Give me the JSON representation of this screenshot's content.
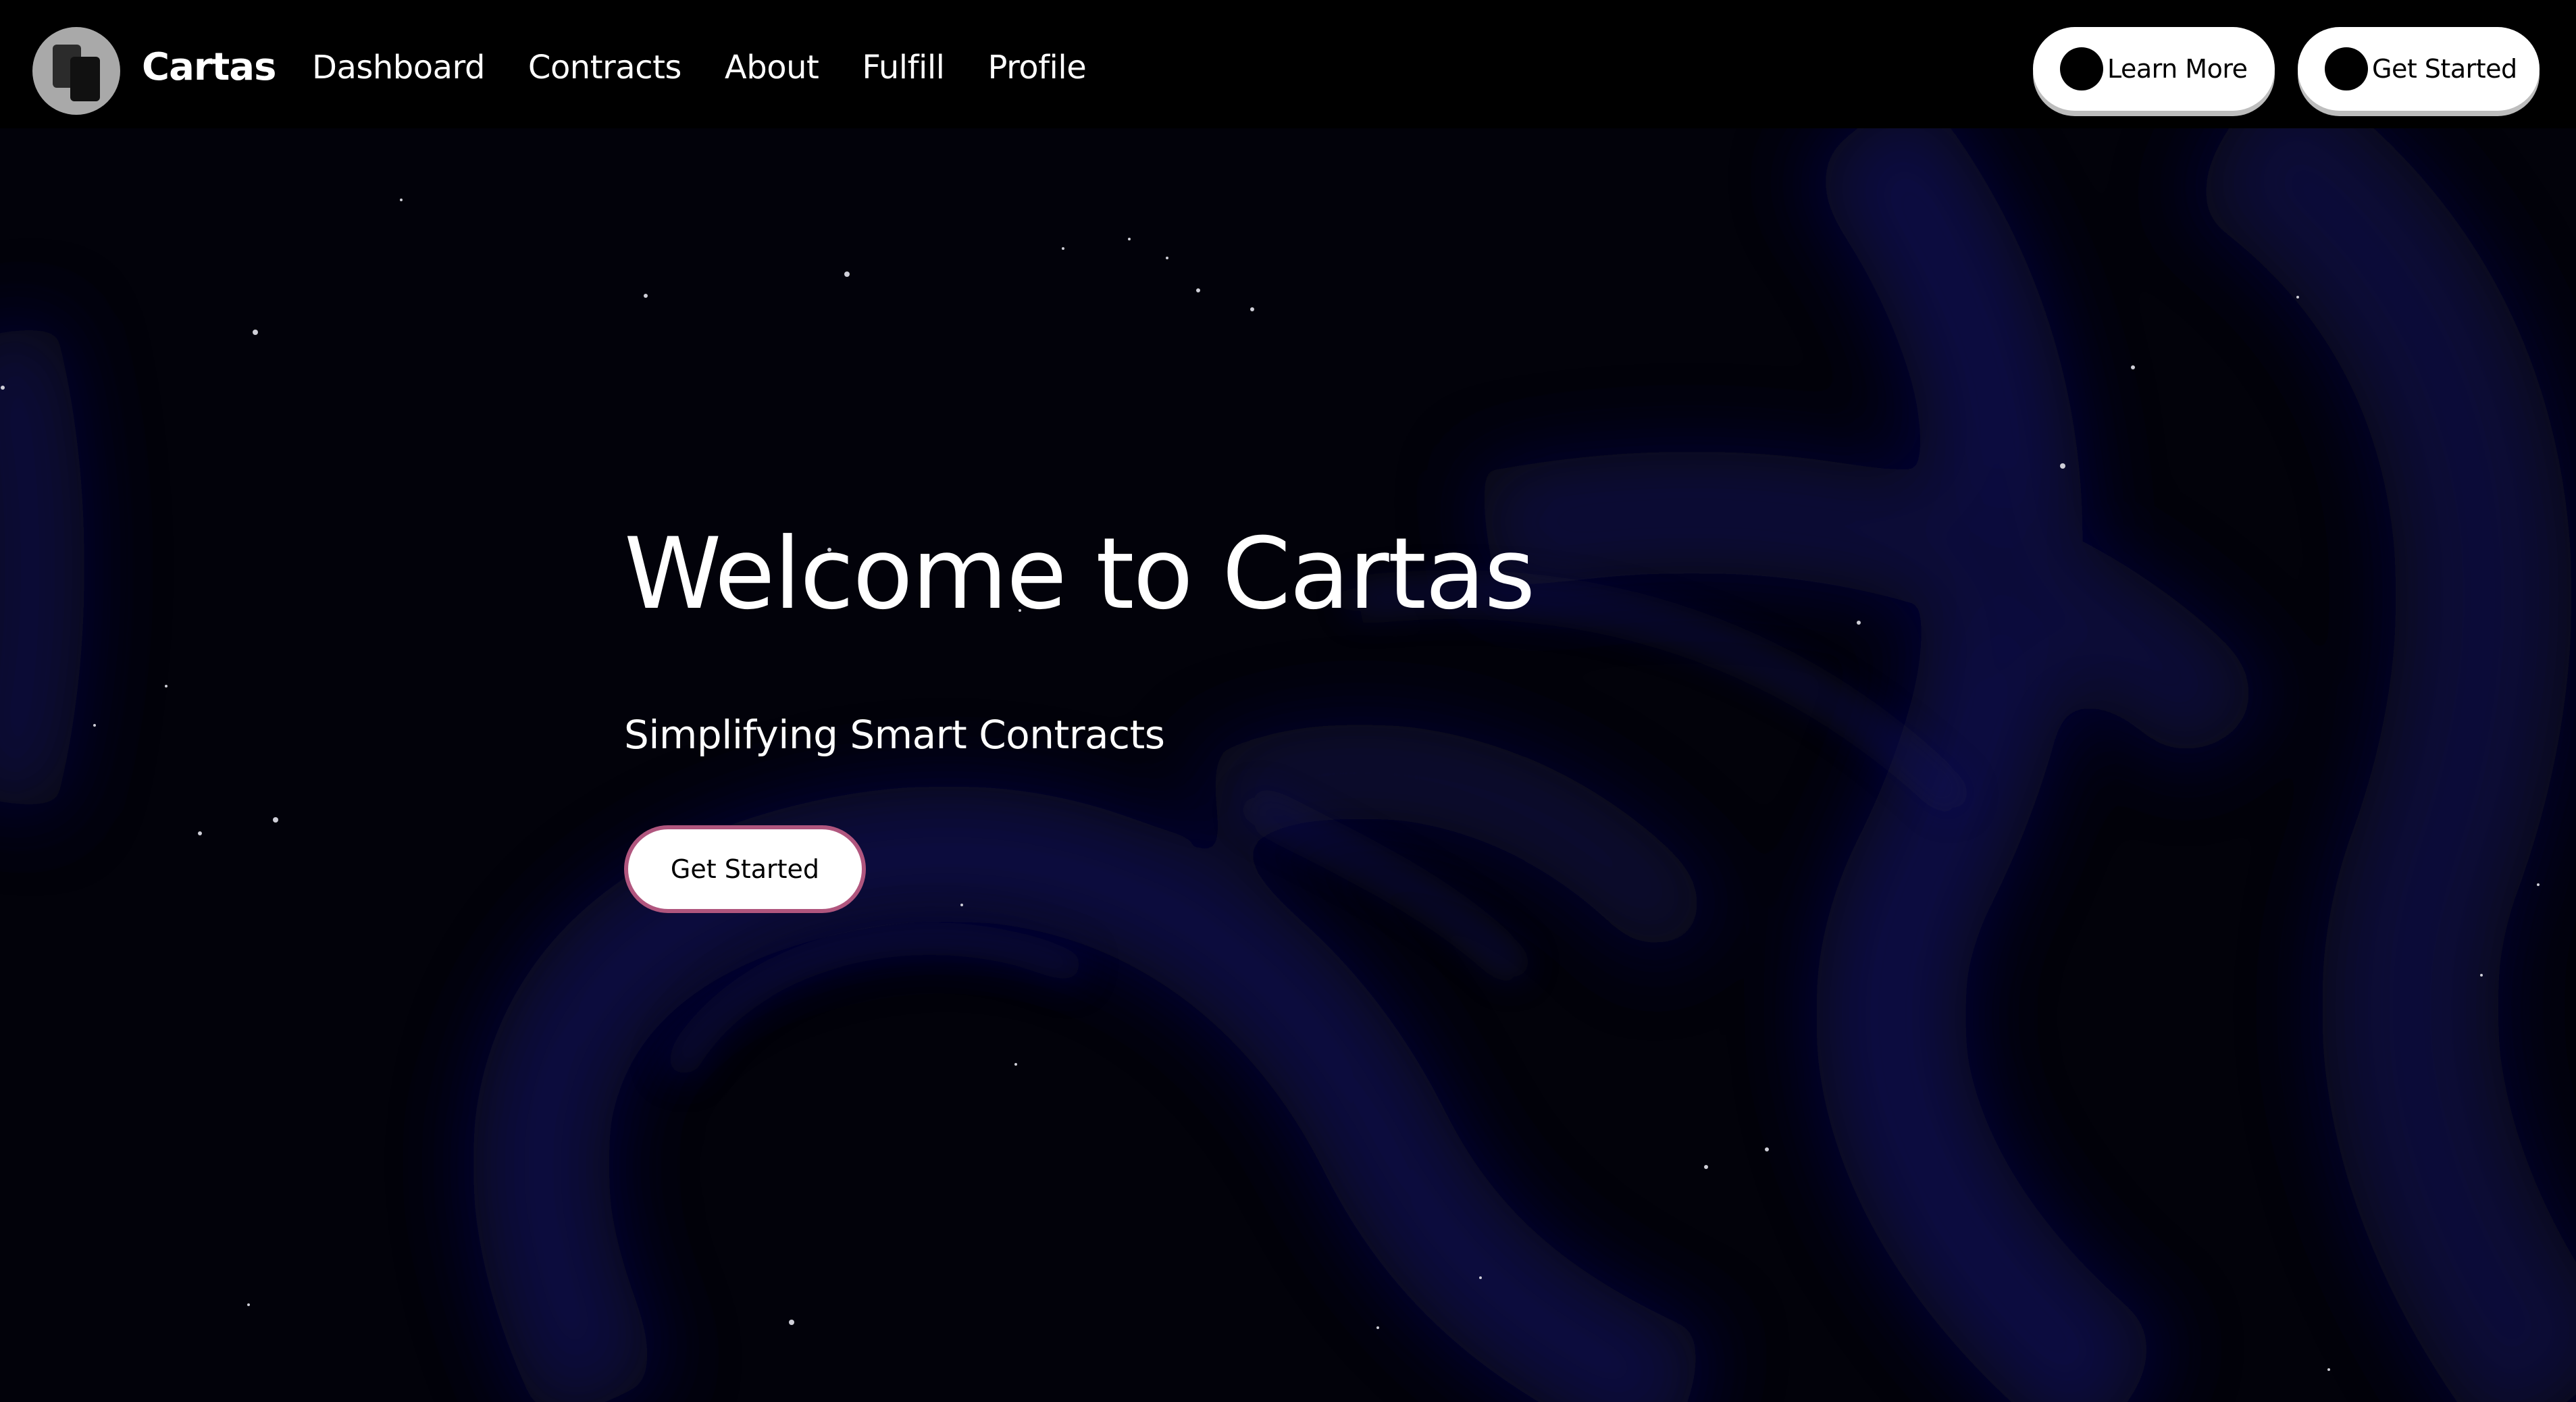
{
  "navbar": {
    "brand": "Cartas",
    "links": [
      {
        "label": "Dashboard"
      },
      {
        "label": "Contracts"
      },
      {
        "label": "About"
      },
      {
        "label": "Fulfill"
      },
      {
        "label": "Profile"
      }
    ],
    "learn_more_label": "Learn More",
    "get_started_label": "Get Started"
  },
  "hero": {
    "title": "Welcome to Cartas",
    "subtitle": "Simplifying Smart Contracts",
    "cta_label": "Get Started"
  },
  "colors": {
    "background": "#000000",
    "nebula": "#0c0c46",
    "button_bg": "#ffffff",
    "cta_border": "#b0567e"
  },
  "icons": {
    "logo": "stacked-cards-icon",
    "button_dot": "dot-icon"
  }
}
